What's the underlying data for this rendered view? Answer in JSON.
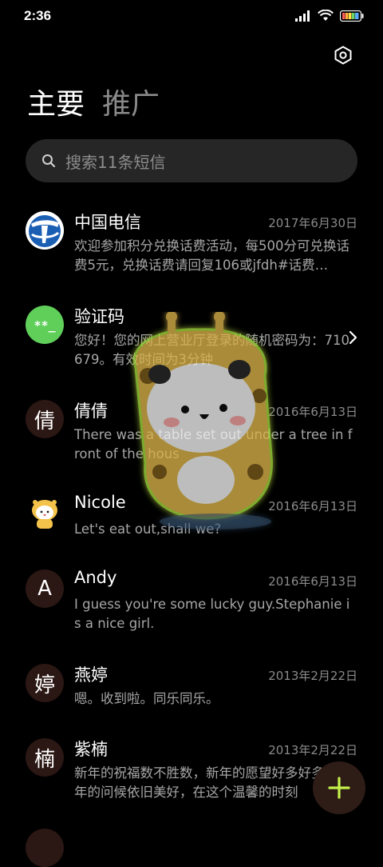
{
  "status_bar": {
    "time": "2:36"
  },
  "header": {
    "tabs": [
      {
        "label": "主要",
        "active": true
      },
      {
        "label": "推广",
        "active": false
      }
    ]
  },
  "search": {
    "placeholder": "搜索11条短信"
  },
  "conversations": [
    {
      "name": "中国电信",
      "date": "2017年6月30日",
      "preview": "欢迎参加积分兑换话费活动，每500分可兑换话费5元，兑换话费请回复106或jfdh#话费…",
      "avatar_icon": "china-telecom-logo"
    },
    {
      "name": "验证码",
      "date": "",
      "preview": "您好！您的网上营业厅登录的随机密码为：710679。有效时间为3分钟",
      "avatar_icon": "password-icon"
    },
    {
      "name": "倩倩",
      "date": "2016年6月13日",
      "preview": "There was a table set out under a tree in front of the hous",
      "avatar_letter": "倩"
    },
    {
      "name": "Nicole",
      "date": "2016年6月13日",
      "preview": "Let's eat out,shall we?",
      "avatar_icon": "cartoon-avatar"
    },
    {
      "name": "Andy",
      "date": "2016年6月13日",
      "preview": "I guess you're some lucky guy.Stephanie is a nice girl.",
      "avatar_letter": "A"
    },
    {
      "name": "燕婷",
      "date": "2013年2月22日",
      "preview": "嗯。收到啦。同乐同乐。",
      "avatar_letter": "婷"
    },
    {
      "name": "紫楠",
      "date": "2013年2月22日",
      "preview": "新年的祝福数不胜数，新年的愿望好多好多，新年的问候依旧美好，在这个温馨的时刻",
      "avatar_letter": "楠"
    }
  ],
  "colors": {
    "background": "#000000",
    "accent_green": "#c5f24a",
    "verify_green": "#5fcf5a",
    "telecom_blue": "#1a5fb4",
    "avatar_bg": "#2b1713"
  }
}
